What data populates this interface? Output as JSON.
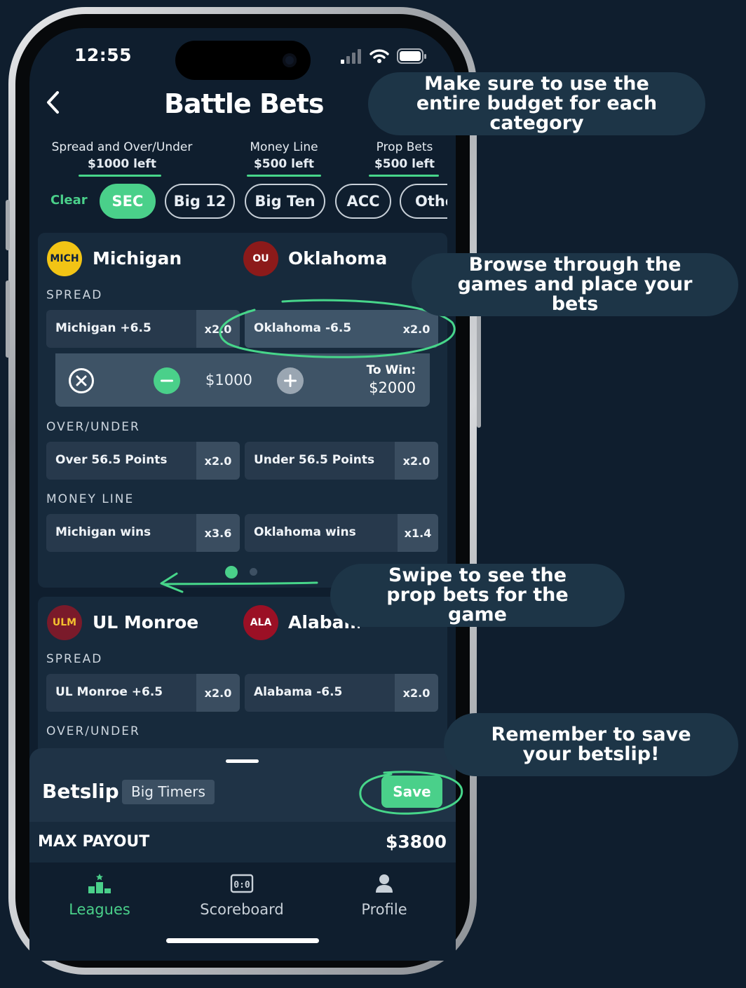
{
  "status": {
    "time": "12:55"
  },
  "header": {
    "title": "Battle Bets"
  },
  "budgets": [
    {
      "label": "Spread and Over/Under",
      "amount": "$1000 left"
    },
    {
      "label": "Money Line",
      "amount": "$500 left"
    },
    {
      "label": "Prop Bets",
      "amount": "$500 left"
    }
  ],
  "filters": {
    "clear": "Clear",
    "chips": [
      "SEC",
      "Big 12",
      "Big Ten",
      "ACC",
      "Othe"
    ],
    "active": "SEC"
  },
  "game1": {
    "home": {
      "abbr": "MICH",
      "name": "Michigan"
    },
    "away": {
      "abbr": "OU",
      "name": "Oklahoma"
    },
    "spread_label": "SPREAD",
    "spread": [
      {
        "label": "Michigan +6.5",
        "odds": "x2.0"
      },
      {
        "label": "Oklahoma -6.5",
        "odds": "x2.0"
      }
    ],
    "stake": {
      "amount": "$1000",
      "to_win_label": "To Win:",
      "to_win": "$2000"
    },
    "ou_label": "OVER/UNDER",
    "ou": [
      {
        "label": "Over 56.5 Points",
        "odds": "x2.0"
      },
      {
        "label": "Under 56.5 Points",
        "odds": "x2.0"
      }
    ],
    "ml_label": "MONEY LINE",
    "ml": [
      {
        "label": "Michigan wins",
        "odds": "x3.6"
      },
      {
        "label": "Oklahoma wins",
        "odds": "x1.4"
      }
    ]
  },
  "game2": {
    "home": {
      "abbr": "ULM",
      "name": "UL Monroe"
    },
    "away": {
      "abbr": "ALA",
      "name": "Alabama"
    },
    "spread_label": "SPREAD",
    "spread": [
      {
        "label": "UL Monroe +6.5",
        "odds": "x2.0"
      },
      {
        "label": "Alabama -6.5",
        "odds": "x2.0"
      }
    ],
    "ou_label": "OVER/UNDER"
  },
  "betslip": {
    "title": "Betslip",
    "tag": "Big Timers",
    "save": "Save",
    "max_payout_label": "MAX PAYOUT",
    "max_payout": "$3800"
  },
  "tabs": [
    {
      "label": "Leagues",
      "active": true
    },
    {
      "label": "Scoreboard"
    },
    {
      "label": "Profile"
    }
  ],
  "callouts": {
    "budget": "Make sure to use the entire budget for each category",
    "browse": "Browse through the games and place your bets",
    "swipe": "Swipe to see the prop bets for the game",
    "save": "Remember to save your betslip!"
  },
  "colors": {
    "background": "#0f1e2e",
    "card": "#172a3c",
    "accent": "#4ad08a",
    "bubble": "#1d3547"
  }
}
